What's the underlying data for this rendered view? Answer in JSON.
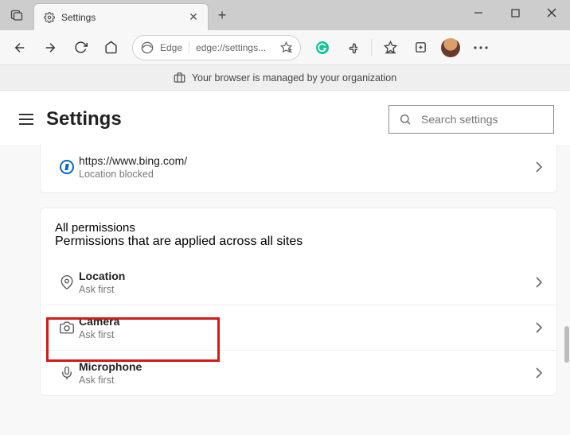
{
  "titlebar": {
    "tab_title": "Settings"
  },
  "toolbar": {
    "edge_label": "Edge",
    "url": "edge://settings..."
  },
  "infobar": {
    "message": "Your browser is managed by your organization"
  },
  "header": {
    "title": "Settings",
    "search_placeholder": "Search settings"
  },
  "recent": {
    "site": "https://www.bing.com/",
    "status": "Location blocked"
  },
  "section": {
    "title": "All permissions",
    "subtitle": "Permissions that are applied across all sites"
  },
  "permissions": {
    "location": {
      "label": "Location",
      "status": "Ask first"
    },
    "camera": {
      "label": "Camera",
      "status": "Ask first"
    },
    "microphone": {
      "label": "Microphone",
      "status": "Ask first"
    }
  }
}
